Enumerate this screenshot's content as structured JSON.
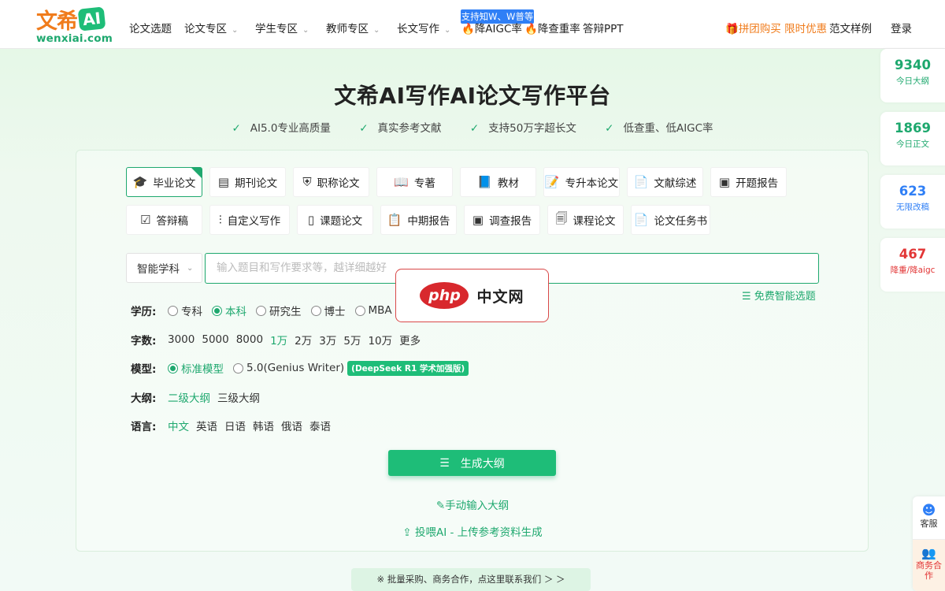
{
  "logo": {
    "cn": "文希",
    "ai": "AI",
    "en": "wenxiai.com"
  },
  "nav": {
    "items": [
      "论文选题",
      "论文专区",
      "学生专区",
      "教师专区",
      "长文写作"
    ],
    "badge": "支持知W、W普等",
    "reduce_aigc": "降AIGC率",
    "reduce_dup": "降查重率",
    "defense_ppt": "答辩PPT",
    "promo": "拼团购买 限时优惠",
    "samples": "范文样例",
    "login": "登录"
  },
  "hero": {
    "title_a": "文希AI写作",
    "title_b": "AI论文写作平台",
    "features": [
      "AI5.0专业高质量",
      "真实参考文献",
      "支持50万字超长文",
      "低查重、低AIGC率"
    ]
  },
  "tabs": {
    "row1": [
      "毕业论文",
      "期刊论文",
      "职称论文",
      "专著",
      "教材",
      "专升本论文",
      "文献综述",
      "开题报告"
    ],
    "row2": [
      "答辩稿",
      "自定义写作",
      "课题论文",
      "中期报告",
      "调查报告",
      "课程论文",
      "论文任务书"
    ]
  },
  "form": {
    "subject_select": "智能学科",
    "topic_placeholder": "输入题目和写作要求等，越详细越好",
    "free_topic_link": "免费智能选题",
    "education": {
      "label": "学历:",
      "options": [
        "专科",
        "本科",
        "研究生",
        "博士",
        "MBA"
      ],
      "selected": "本科"
    },
    "word_count": {
      "label": "字数:",
      "options": [
        "3000",
        "5000",
        "8000",
        "1万",
        "2万",
        "3万",
        "5万",
        "10万",
        "更多"
      ],
      "selected": "1万"
    },
    "model": {
      "label": "模型:",
      "options": [
        "标准模型",
        "5.0(Genius Writer)"
      ],
      "selected": "标准模型",
      "tag": "(DeepSeek R1 学术加强版)"
    },
    "outline": {
      "label": "大纲:",
      "options": [
        "二级大纲",
        "三级大纲"
      ],
      "selected": "二级大纲"
    },
    "language": {
      "label": "语言:",
      "options": [
        "中文",
        "英语",
        "日语",
        "韩语",
        "俄语",
        "泰语"
      ],
      "selected": "中文"
    },
    "generate_button": "生成大纲",
    "manual_outline": "手动输入大纲",
    "upload_link": "投喂AI - 上传参考资料生成"
  },
  "stats": [
    {
      "num": "9340",
      "label": "今日大纲",
      "color": "#1ea86e"
    },
    {
      "num": "1869",
      "label": "今日正文",
      "color": "#1ea86e"
    },
    {
      "num": "623",
      "label": "无限改稿",
      "color": "#2f7ff6"
    },
    {
      "num": "467",
      "label": "降重/降aigc",
      "color": "#e23636"
    }
  ],
  "side": {
    "service": "客服",
    "business": "商务合作"
  },
  "bottom_bar": "※ 批量采购、商务合作，点这里联系我们 ＞ ＞",
  "watermark": {
    "php": "php",
    "cn": "中文网"
  }
}
